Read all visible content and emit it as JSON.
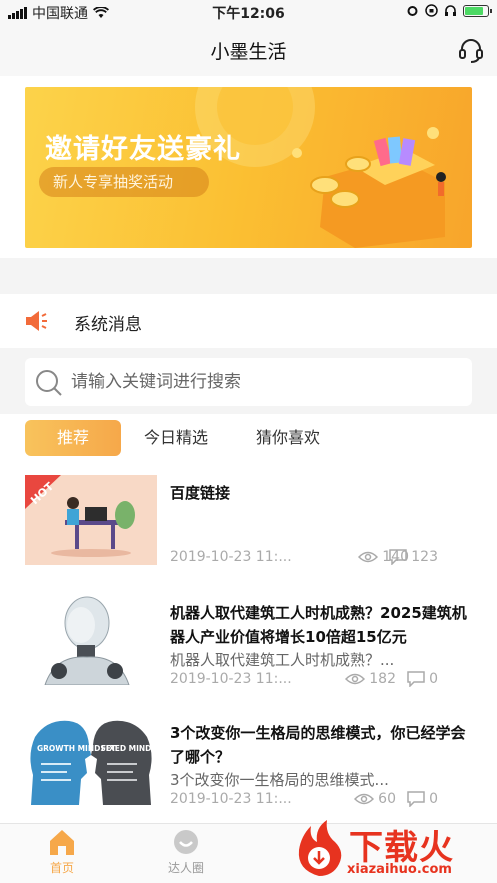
{
  "status_bar": {
    "carrier": "中国联通",
    "time": "下午12:06"
  },
  "nav": {
    "title": "小墨生活"
  },
  "banner": {
    "headline": "邀请好友送豪礼",
    "subtitle": "新人专享抽奖活动"
  },
  "notice": {
    "label": "系统消息"
  },
  "search": {
    "placeholder": "请输入关键词进行搜索"
  },
  "tabs": [
    {
      "label": "推荐"
    },
    {
      "label": "今日精选"
    },
    {
      "label": "猜你喜欢"
    }
  ],
  "articles": [
    {
      "title": "百度链接",
      "summary": "",
      "badge": "HOT",
      "date": "2019-10-23 11:...",
      "views": "140",
      "comments": "123"
    },
    {
      "title": "机器人取代建筑工人时机成熟？2025建筑机器人产业价值将增长10倍超15亿元",
      "summary": "机器人取代建筑工人时机成熟？...",
      "date": "2019-10-23 11:...",
      "views": "182",
      "comments": "0"
    },
    {
      "title": "3个改变你一生格局的思维模式，你已经学会了哪个？",
      "summary": "3个改变你一生格局的思维模式...",
      "date": "2019-10-23 11:...",
      "views": "60",
      "comments": "0",
      "thumb_left": "GROWTH MINDSET",
      "thumb_right": "FIXED MINDSET"
    }
  ],
  "tabbar": [
    {
      "label": "首页"
    },
    {
      "label": "达人圈"
    }
  ],
  "watermark": {
    "text": "下载火",
    "url": "xiazaihuo.com"
  },
  "colors": {
    "accent": "#f6a84a",
    "banner": "#fbbf32",
    "watermark": "#e7331f",
    "battery": "#4cd964"
  }
}
